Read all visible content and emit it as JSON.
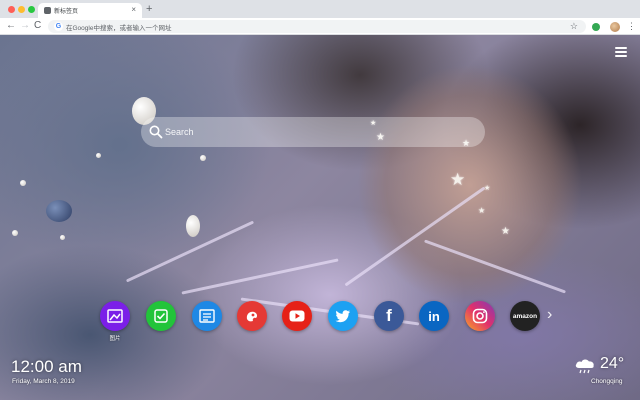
{
  "browser": {
    "tab": {
      "title": "新标签页",
      "close_glyph": "×"
    },
    "new_tab_glyph": "+",
    "nav": {
      "back_glyph": "←",
      "forward_glyph": "→",
      "reload_glyph": "C"
    },
    "omnibox": {
      "placeholder": "在Google中搜索，或者输入一个网址",
      "search_engine_glyph": "G"
    },
    "star_glyph": "☆",
    "menu_glyph": "⋮"
  },
  "newtab": {
    "search": {
      "placeholder": "Search",
      "icon": "search-icon"
    },
    "apps": [
      {
        "name": "photo-app",
        "icon": "image-icon",
        "color": "#7b1fe8",
        "label": "图片"
      },
      {
        "name": "check-app",
        "icon": "checkmark-icon",
        "color": "#22c43a",
        "label": ""
      },
      {
        "name": "news-app",
        "icon": "newspaper-icon",
        "color": "#1e88e5",
        "label": ""
      },
      {
        "name": "game-app",
        "icon": "gamepad-icon",
        "color": "#e53935",
        "label": ""
      },
      {
        "name": "youtube-app",
        "icon": "youtube-play-icon",
        "color": "#e62117",
        "label": ""
      },
      {
        "name": "twitter-app",
        "icon": "twitter-bird-icon",
        "color": "#1da1f2",
        "label": ""
      },
      {
        "name": "facebook-app",
        "icon": "facebook-icon",
        "color": "#3b5998",
        "label": "",
        "glyph": "f"
      },
      {
        "name": "linkedin-app",
        "icon": "linkedin-icon",
        "color": "#0a66c2",
        "label": "",
        "glyph": "in"
      },
      {
        "name": "instagram-app",
        "icon": "instagram-icon",
        "color": "#c13584",
        "label": ""
      },
      {
        "name": "amazon-app",
        "icon": "amazon-icon",
        "color": "#222222",
        "label": "",
        "glyph": "amazon"
      }
    ],
    "next_arrow_glyph": "›",
    "clock": {
      "time": "12:00 am",
      "date": "Friday, March 8, 2019"
    },
    "weather": {
      "temp": "24°",
      "city": "Chongqing",
      "icon": "cloud-rain-icon"
    }
  }
}
